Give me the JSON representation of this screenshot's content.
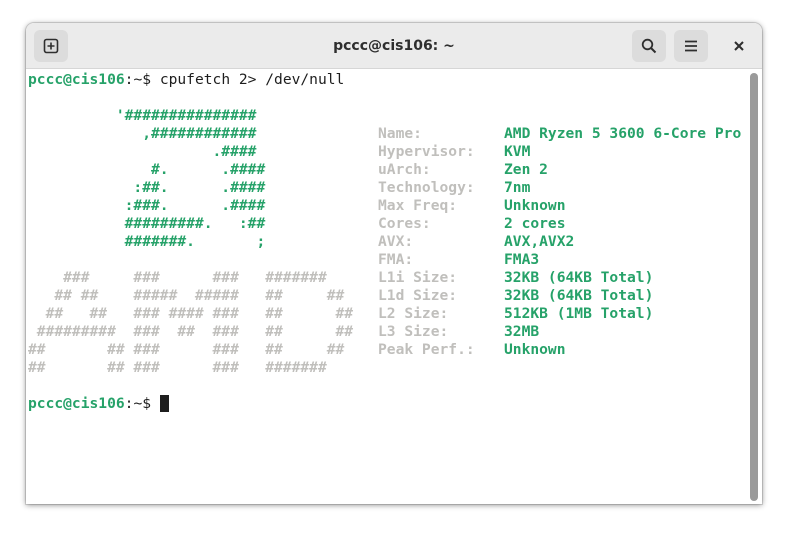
{
  "window": {
    "title": "pccc@cis106: ~"
  },
  "icons": {
    "new_tab": "new-tab-icon",
    "search": "search-icon",
    "menu": "hamburger-menu-icon",
    "close": "close-icon"
  },
  "colors": {
    "green": "#26a269",
    "gray_text": "#c0bfbc",
    "fg": "#1e1e1e",
    "titlebar": "#ebebeb"
  },
  "terminal": {
    "prompt1": {
      "user_host": "pccc@cis106",
      "path_sym": ":~$ ",
      "command": "cpufetch 2> /dev/null"
    },
    "logo_green": [
      "          '###############",
      "             ,############",
      "                     .####",
      "              #.      .####",
      "            :##.      .####",
      "           :###.      .####",
      "           #########.   :##",
      "           #######.       ;"
    ],
    "logo_gray": [
      "    ###     ###      ###   #######",
      "   ## ##    #####  #####   ##     ##",
      "  ##   ##   ### #### ###   ##      ##",
      " #########  ###  ##  ###   ##      ##",
      "##       ## ###      ###   ##     ##",
      "##       ## ###      ###   #######"
    ],
    "info": [
      {
        "label": "Name:",
        "value": "AMD Ryzen 5 3600 6-Core Pro"
      },
      {
        "label": "Hypervisor:",
        "value": "KVM"
      },
      {
        "label": "uArch:",
        "value": "Zen 2"
      },
      {
        "label": "Technology:",
        "value": "7nm"
      },
      {
        "label": "Max Freq:",
        "value": "Unknown"
      },
      {
        "label": "Cores:",
        "value": "2 cores"
      },
      {
        "label": "AVX:",
        "value": "AVX,AVX2"
      },
      {
        "label": "FMA:",
        "value": "FMA3"
      },
      {
        "label": "L1i Size:",
        "value": "32KB (64KB Total)"
      },
      {
        "label": "L1d Size:",
        "value": "32KB (64KB Total)"
      },
      {
        "label": "L2 Size:",
        "value": "512KB (1MB Total)"
      },
      {
        "label": "L3 Size:",
        "value": "32MB"
      },
      {
        "label": "Peak Perf.:",
        "value": "Unknown"
      }
    ],
    "prompt2": {
      "user_host": "pccc@cis106",
      "path_sym": ":~$ "
    }
  }
}
